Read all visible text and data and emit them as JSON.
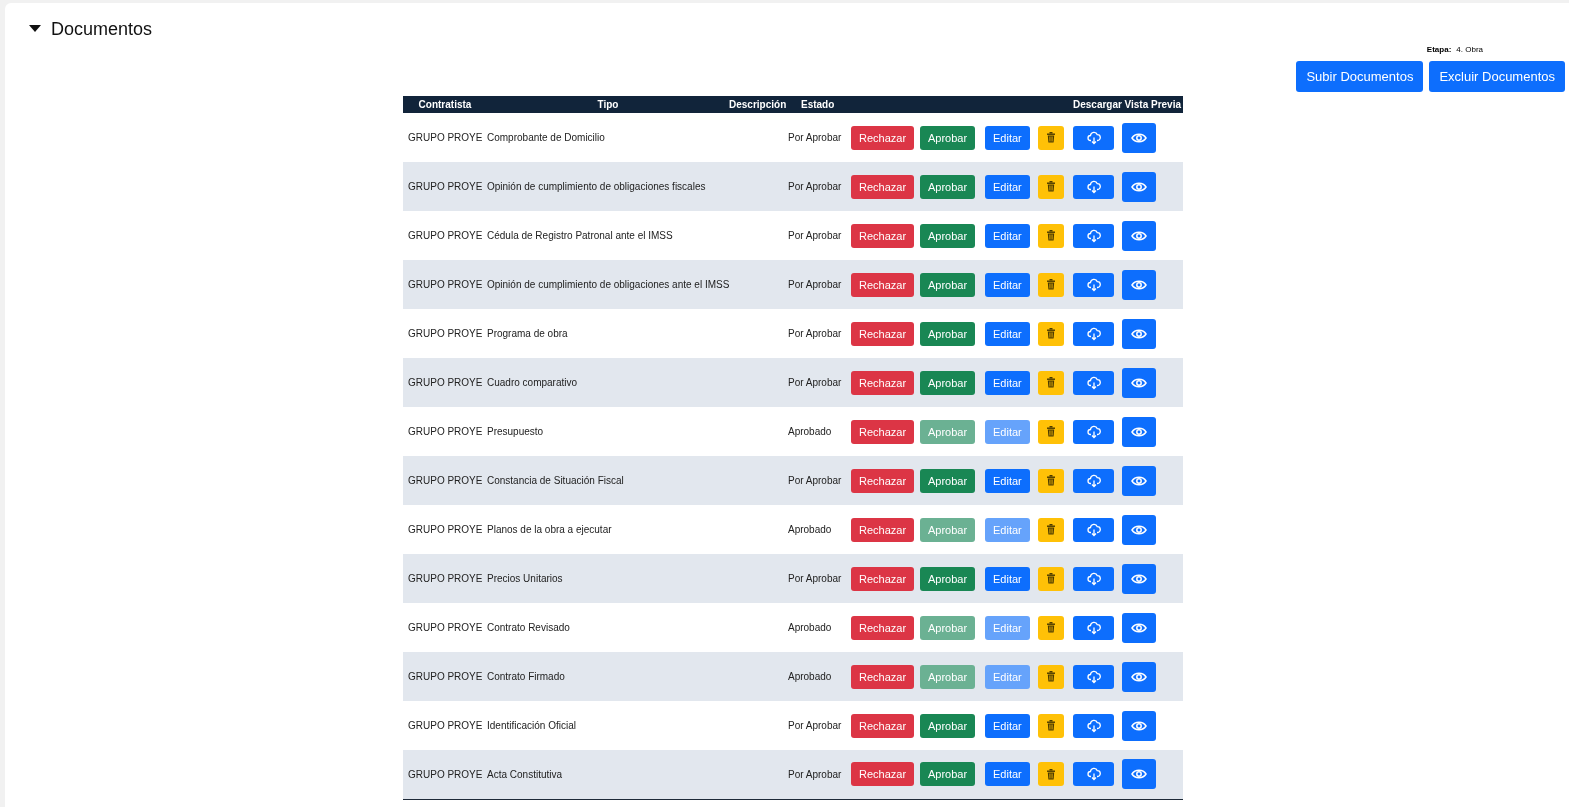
{
  "section": {
    "title": "Documentos",
    "expanded": true
  },
  "stage": {
    "label": "Etapa:",
    "value": "4. Obra"
  },
  "actions": [
    "Subir Documentos",
    "Excluir Documentos"
  ],
  "table": {
    "columns": [
      "Contratista",
      "Tipo",
      "Descripción",
      "Estado",
      "Descargar",
      "Vista Previa"
    ],
    "rows": [
      {
        "contractor": "GRUPO PROYE",
        "type": "Comprobante de Domicilio",
        "status": "Por Aprobar",
        "reject": "Rechazar",
        "approve": {
          "label": "Aprobar",
          "disabled": false
        },
        "edit": {
          "label": "Editar",
          "disabled": false
        }
      },
      {
        "contractor": "GRUPO PROYE",
        "type": "Opinión de cumplimiento de obligaciones fiscales",
        "status": "Por Aprobar",
        "reject": "Rechazar",
        "approve": {
          "label": "Aprobar",
          "disabled": false
        },
        "edit": {
          "label": "Editar",
          "disabled": false
        }
      },
      {
        "contractor": "GRUPO PROYE",
        "type": "Cédula de Registro Patronal ante el IMSS",
        "status": "Por Aprobar",
        "reject": "Rechazar",
        "approve": {
          "label": "Aprobar",
          "disabled": false
        },
        "edit": {
          "label": "Editar",
          "disabled": false
        }
      },
      {
        "contractor": "GRUPO PROYE",
        "type": "Opinión de cumplimiento de obligaciones ante el IMSS",
        "status": "Por Aprobar",
        "reject": "Rechazar",
        "approve": {
          "label": "Aprobar",
          "disabled": false
        },
        "edit": {
          "label": "Editar",
          "disabled": false
        }
      },
      {
        "contractor": "GRUPO PROYE",
        "type": "Programa de obra",
        "status": "Por Aprobar",
        "reject": "Rechazar",
        "approve": {
          "label": "Aprobar",
          "disabled": false
        },
        "edit": {
          "label": "Editar",
          "disabled": false
        }
      },
      {
        "contractor": "GRUPO PROYE",
        "type": "Cuadro comparativo",
        "status": "Por Aprobar",
        "reject": "Rechazar",
        "approve": {
          "label": "Aprobar",
          "disabled": false
        },
        "edit": {
          "label": "Editar",
          "disabled": false
        }
      },
      {
        "contractor": "GRUPO PROYE",
        "type": "Presupuesto",
        "status": "Aprobado",
        "reject": "Rechazar",
        "approve": {
          "label": "Aprobar",
          "disabled": true
        },
        "edit": {
          "label": "Editar",
          "disabled": true
        }
      },
      {
        "contractor": "GRUPO PROYE",
        "type": "Constancia de Situación Fiscal",
        "status": "Por Aprobar",
        "reject": "Rechazar",
        "approve": {
          "label": "Aprobar",
          "disabled": false
        },
        "edit": {
          "label": "Editar",
          "disabled": false
        }
      },
      {
        "contractor": "GRUPO PROYE",
        "type": "Planos de la obra a ejecutar",
        "status": "Aprobado",
        "reject": "Rechazar",
        "approve": {
          "label": "Aprobar",
          "disabled": true
        },
        "edit": {
          "label": "Editar",
          "disabled": true
        }
      },
      {
        "contractor": "GRUPO PROYE",
        "type": "Precios Unitarios",
        "status": "Por Aprobar",
        "reject": "Rechazar",
        "approve": {
          "label": "Aprobar",
          "disabled": false
        },
        "edit": {
          "label": "Editar",
          "disabled": false
        }
      },
      {
        "contractor": "GRUPO PROYE",
        "type": "Contrato Revisado",
        "status": "Aprobado",
        "reject": "Rechazar",
        "approve": {
          "label": "Aprobar",
          "disabled": true
        },
        "edit": {
          "label": "Editar",
          "disabled": true
        }
      },
      {
        "contractor": "GRUPO PROYE",
        "type": "Contrato Firmado",
        "status": "Aprobado",
        "reject": "Rechazar",
        "approve": {
          "label": "Aprobar",
          "disabled": true
        },
        "edit": {
          "label": "Editar",
          "disabled": true
        }
      },
      {
        "contractor": "GRUPO PROYE",
        "type": "Identificación Oficial",
        "status": "Por Aprobar",
        "reject": "Rechazar",
        "approve": {
          "label": "Aprobar",
          "disabled": false
        },
        "edit": {
          "label": "Editar",
          "disabled": false
        }
      },
      {
        "contractor": "GRUPO PROYE",
        "type": "Acta Constitutiva",
        "status": "Por Aprobar",
        "reject": "Rechazar",
        "approve": {
          "label": "Aprobar",
          "disabled": false
        },
        "edit": {
          "label": "Editar",
          "disabled": false
        }
      }
    ]
  }
}
